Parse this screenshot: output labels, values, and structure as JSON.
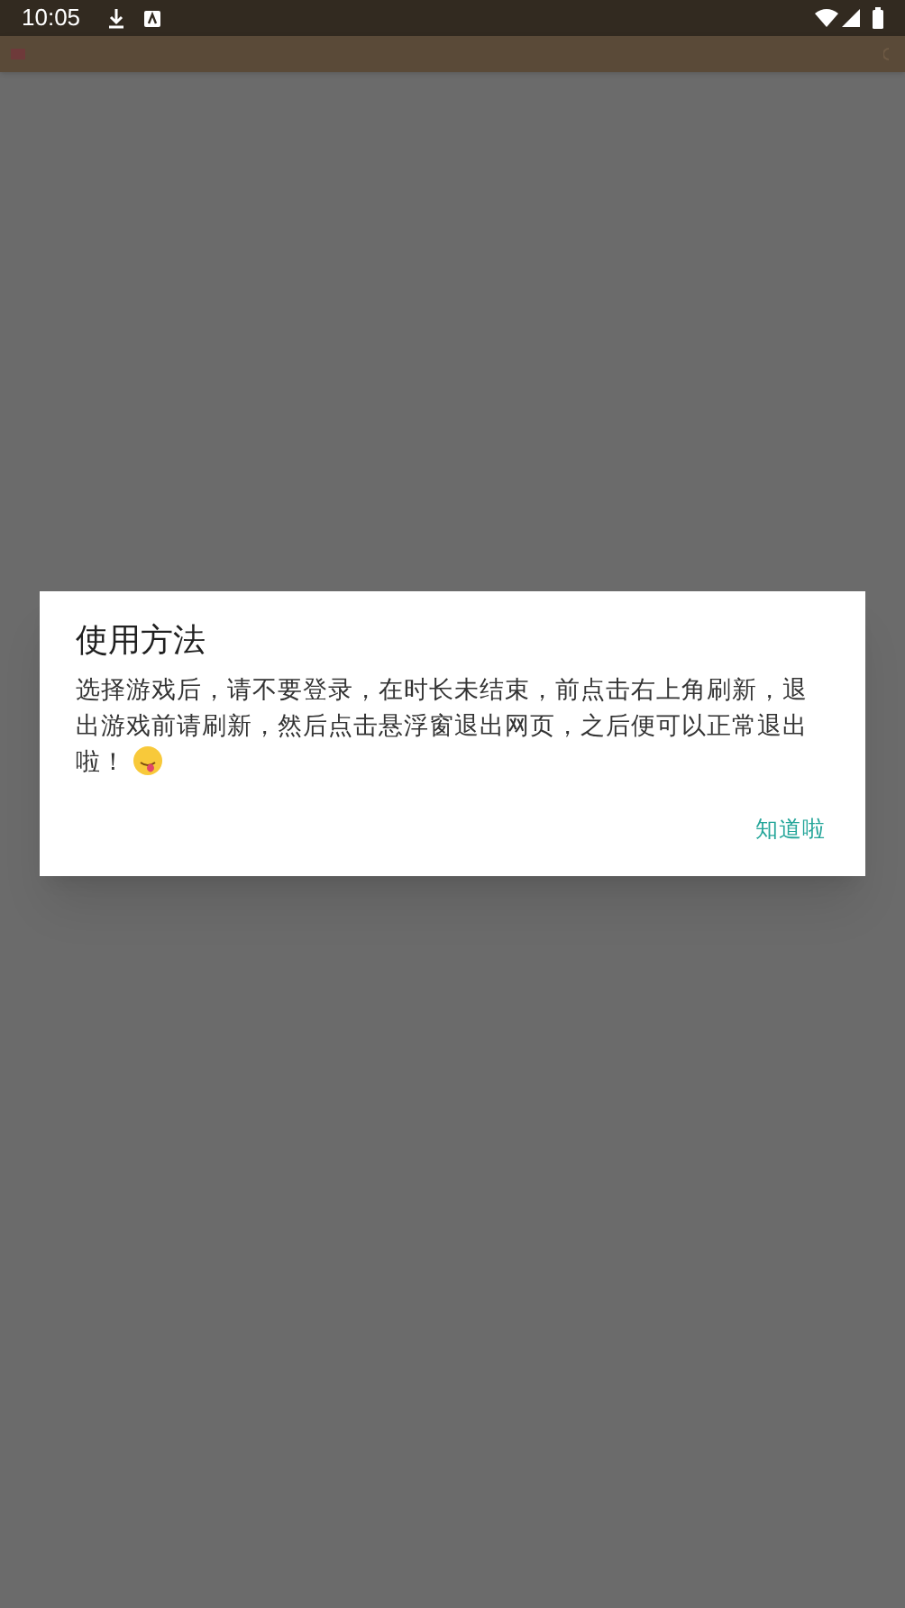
{
  "status_bar": {
    "time": "10:05"
  },
  "dialog": {
    "title": "使用方法",
    "message": "选择游戏后，请不要登录，在时长未结束，前点击右上角刷新，退出游戏前请刷新，然后点击悬浮窗退出网页，之后便可以正常退出啦！",
    "button": "知道啦"
  }
}
